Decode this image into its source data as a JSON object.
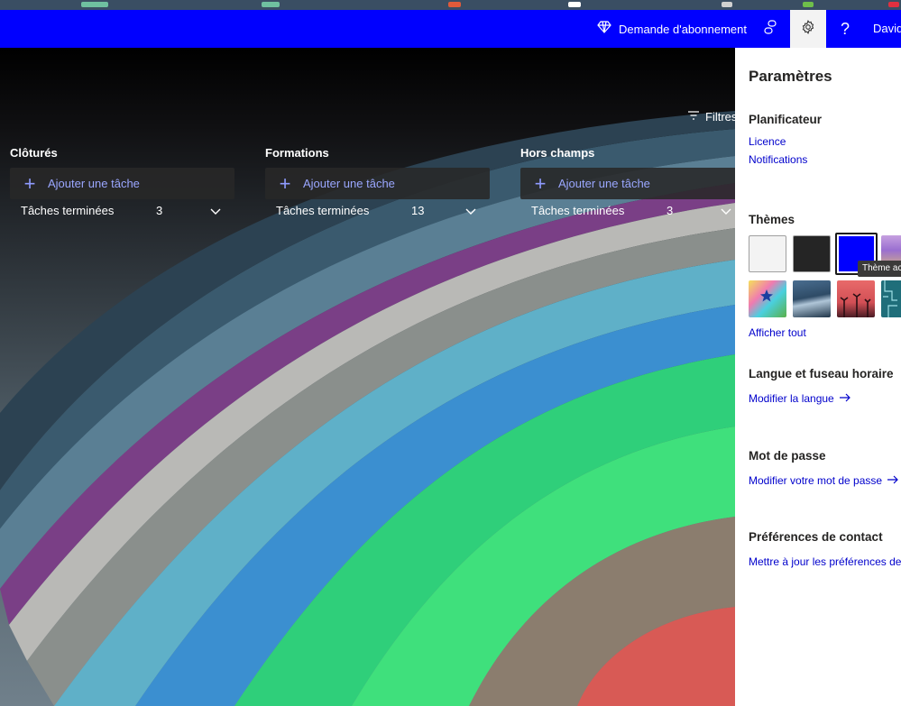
{
  "header": {
    "subscription_label": "Demande d'abonnement",
    "user_name": "David",
    "help_glyph": "?",
    "icons": [
      "diamond-icon",
      "share-icon",
      "gear-icon",
      "help-icon"
    ],
    "accent_color": "#0000ff"
  },
  "board": {
    "filters_label": "Filtres",
    "columns": [
      {
        "title": "Clôturés",
        "add_task_label": "Ajouter une tâche",
        "completed_label": "Tâches terminées",
        "completed_count": "3"
      },
      {
        "title": "Formations",
        "add_task_label": "Ajouter une tâche",
        "completed_label": "Tâches terminées",
        "completed_count": "13"
      },
      {
        "title": "Hors champs",
        "add_task_label": "Ajouter une tâche",
        "completed_label": "Tâches terminées",
        "completed_count": "3"
      }
    ]
  },
  "settings": {
    "title": "Paramètres",
    "planner": {
      "title": "Planificateur",
      "links": [
        "Licence",
        "Notifications"
      ]
    },
    "themes": {
      "title": "Thèmes",
      "tooltip": "Thème ac",
      "show_all_label": "Afficher tout",
      "selected_color": "#0000ff"
    },
    "language": {
      "title": "Langue et fuseau horaire",
      "link": "Modifier la langue"
    },
    "password": {
      "title": "Mot de passe",
      "link": "Modifier votre mot de passe"
    },
    "contact": {
      "title": "Préférences de contact",
      "link": "Mettre à jour les préférences de"
    }
  }
}
